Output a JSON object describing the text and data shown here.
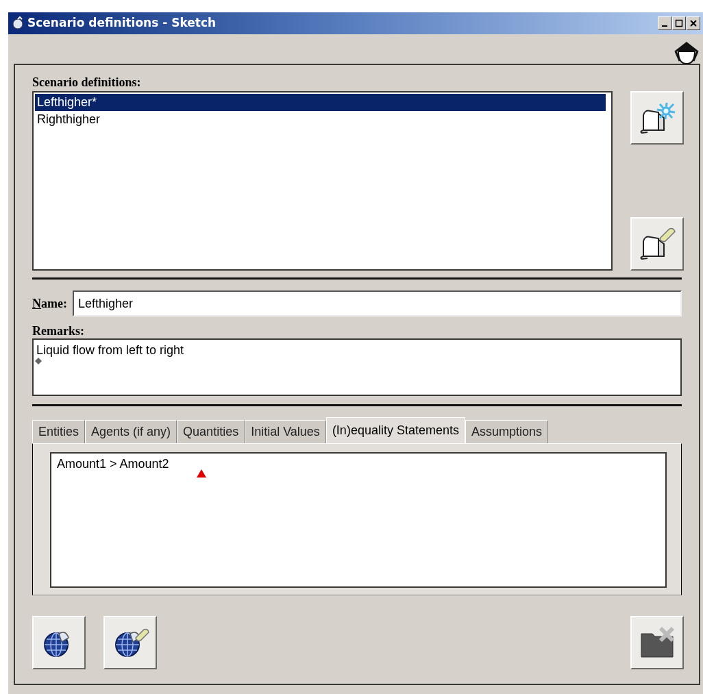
{
  "window": {
    "title": "Scenario definitions - Sketch"
  },
  "scenario_list": {
    "label": "Scenario definitions:",
    "items": [
      {
        "text": "Lefthigher*",
        "selected": true
      },
      {
        "text": "Righthigher",
        "selected": false
      }
    ]
  },
  "name_field": {
    "label": "Name:",
    "mnemonic_underlined": true,
    "value": "Lefthigher"
  },
  "remarks": {
    "label": "Remarks:",
    "value": "Liquid flow from left to right"
  },
  "tabs": [
    {
      "label": "Entities",
      "selected": false
    },
    {
      "label": "Agents (if any)",
      "selected": false
    },
    {
      "label": "Quantities",
      "selected": false
    },
    {
      "label": "Initial Values",
      "selected": false
    },
    {
      "label": "(In)equality Statements",
      "selected": true
    },
    {
      "label": "Assumptions",
      "selected": false
    }
  ],
  "tab_content": {
    "lines": [
      "Amount1 > Amount2"
    ]
  }
}
